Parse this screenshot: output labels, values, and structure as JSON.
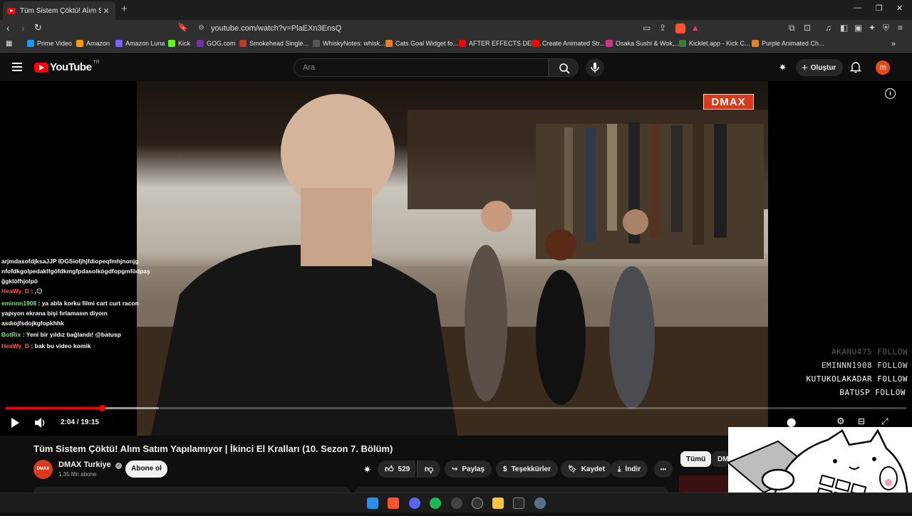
{
  "browser": {
    "tab_title": "Tüm Sistem Çöktü! Alım Satım Y...",
    "new_tab": "+",
    "url": "youtube.com/watch?v=PlaEXn3EnsQ",
    "bookmarks": [
      {
        "label": "Prime Video",
        "color": "#1a98ff"
      },
      {
        "label": "Amazon",
        "color": "#ff9900"
      },
      {
        "label": "Amazon Luna",
        "color": "#7b61ff"
      },
      {
        "label": "Kick",
        "color": "#53fc18"
      },
      {
        "label": "GOG.com",
        "color": "#7a2fa8"
      },
      {
        "label": "Smokehead Single...",
        "color": "#c0392b"
      },
      {
        "label": "WhiskyNotes: whisk...",
        "color": "#555555"
      },
      {
        "label": "Cats Goal Widget fo...",
        "color": "#e67e22"
      },
      {
        "label": "AFTER EFFECTS DER...",
        "color": "#ff0000"
      },
      {
        "label": "Create Animated Str...",
        "color": "#ff0000"
      },
      {
        "label": "Osaka Sushi & Wok,...",
        "color": "#d32f8b"
      },
      {
        "label": "Kicklet.app - Kick C...",
        "color": "#3a7d3a"
      },
      {
        "label": "Purple Animated Ch...",
        "color": "#e67e22"
      }
    ],
    "bookmark_overflow": "»"
  },
  "youtube": {
    "logo_text": "YouTube",
    "country_code": "TR",
    "search_placeholder": "Ara",
    "create_label": "Oluştur",
    "avatar_letter": "m"
  },
  "player": {
    "channel_bug": "DMAX",
    "time_current": "2:04",
    "time_separator": "/",
    "time_total": "19:15",
    "progress_fraction": 0.107,
    "buffered_fraction": 0.17,
    "chat": [
      {
        "user": "",
        "user_color": "#ffffff",
        "text": "arjmdasofdjksaJJP IDGSiofjhjfdiopeqfmhjnonjg"
      },
      {
        "user": "",
        "user_color": "#ffffff",
        "text": "nfofdkgolpedaklfgöfdkmgfpdasolkögdfopgmfödpaş"
      },
      {
        "user": "",
        "user_color": "#ffffff",
        "text": "ğgklöfhjolpö"
      },
      {
        "user": "HeaWy_D",
        "user_color": "#ff5a5a",
        "text": ": ,😊"
      },
      {
        "user": "eminnn1908",
        "user_color": "#7fe07f",
        "text": ": ya abla korku filmi cart curt racon"
      },
      {
        "user": "",
        "user_color": "#ffffff",
        "text": "yapıyon ekrana bişi fırlamasın diyoın"
      },
      {
        "user": "",
        "user_color": "#ffffff",
        "text": "asdıojfsdojkgfopkhhk"
      },
      {
        "user": "BotRix",
        "user_color": "#7fe07f",
        "text": ": Yeni bir yıldız bağlandı! @batusp"
      },
      {
        "user": "HeaWy_D",
        "user_color": "#ff5a5a",
        "text": ": bak bu video komik"
      }
    ],
    "follows": [
      {
        "name": "AKANU475",
        "label": "FOLLOW",
        "opacity": 0.35
      },
      {
        "name": "EMINNN1908",
        "label": "FOLLOW",
        "opacity": 0.85
      },
      {
        "name": "KUTUKOLAKADAR",
        "label": "FOLLOW",
        "opacity": 1
      },
      {
        "name": "BATUSP",
        "label": "FOLLOW",
        "opacity": 1
      }
    ]
  },
  "video": {
    "title": "Tüm Sistem Çöktü! Alım Satım Yapılamıyor | İkinci El Kralları (10. Sezon 7. Bölüm)",
    "channel_avatar_text": "DMAX",
    "channel_name": "DMAX Turkiye",
    "subscribers": "1,35 Mn abone",
    "subscribe_label": "Abone ol",
    "likes": "529",
    "share_label": "Paylaş",
    "thanks_label": "Teşekkürler",
    "save_label": "Kaydet",
    "download_label": "İndir",
    "more_label": "•••",
    "chip_all": "Tümü",
    "chip_dmax": "DMAX"
  }
}
